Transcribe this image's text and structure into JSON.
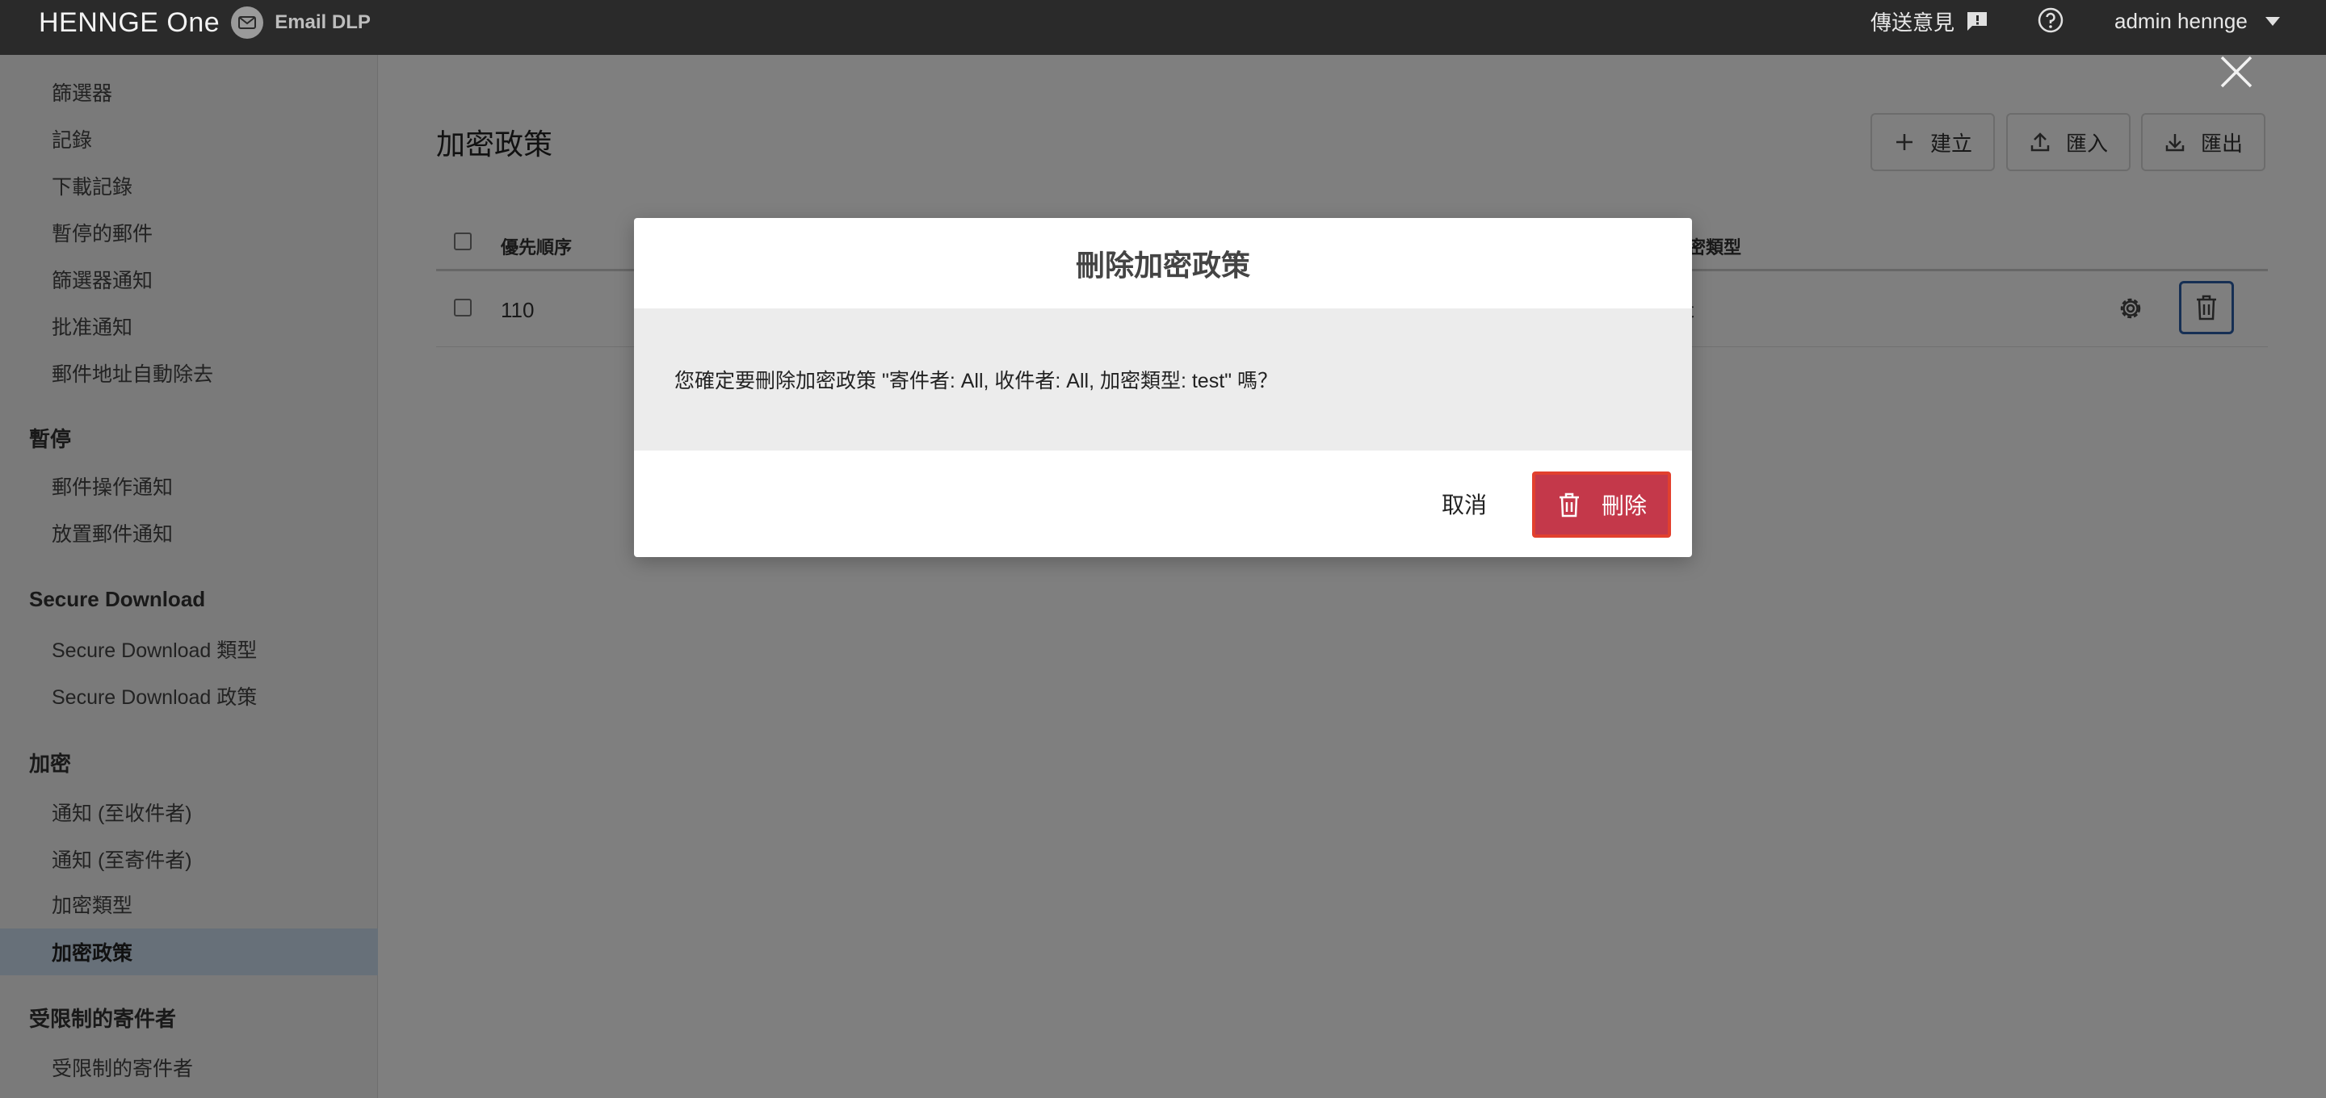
{
  "header": {
    "brand_name": "HENNGE One",
    "product_name": "Email DLP",
    "feedback_label": "傳送意見",
    "user_name": "admin hennge"
  },
  "sidebar": {
    "items_top": [
      {
        "label": "篩選器"
      },
      {
        "label": "記錄"
      },
      {
        "label": "下載記錄"
      },
      {
        "label": "暫停的郵件"
      },
      {
        "label": "篩選器通知"
      },
      {
        "label": "批准通知"
      },
      {
        "label": "郵件地址自動除去"
      }
    ],
    "section_suspend": {
      "title": "暫停",
      "items": [
        {
          "label": "郵件操作通知"
        },
        {
          "label": "放置郵件通知"
        }
      ]
    },
    "section_secure_download": {
      "title": "Secure Download",
      "items": [
        {
          "label": "Secure Download 類型"
        },
        {
          "label": "Secure Download 政策"
        }
      ]
    },
    "section_encryption": {
      "title": "加密",
      "items": [
        {
          "label": "通知 (至收件者)"
        },
        {
          "label": "通知 (至寄件者)"
        },
        {
          "label": "加密類型"
        },
        {
          "label": "加密政策"
        }
      ]
    },
    "section_restricted": {
      "title": "受限制的寄件者",
      "items": [
        {
          "label": "受限制的寄件者"
        }
      ]
    },
    "active_item": "加密政策"
  },
  "main": {
    "page_title": "加密政策",
    "toolbar": {
      "create_label": "建立",
      "import_label": "匯入",
      "export_label": "匯出"
    },
    "table": {
      "columns": [
        "優先順序",
        "密類型"
      ],
      "rows": [
        {
          "priority": "110",
          "type_partial": "t"
        }
      ]
    }
  },
  "modal": {
    "title": "刪除加密政策",
    "message": "您確定要刪除加密政策 \"寄件者: All, 收件者: All, 加密類型: test\" 嗎？",
    "cancel_label": "取消",
    "delete_label": "刪除"
  },
  "colors": {
    "topbar": "#2a2a2a",
    "sidebar_active": "#cfe0f2",
    "delete_button": "#c4384a",
    "delete_highlight": "#e2402e",
    "row_delete_border": "#2d5fa8"
  }
}
